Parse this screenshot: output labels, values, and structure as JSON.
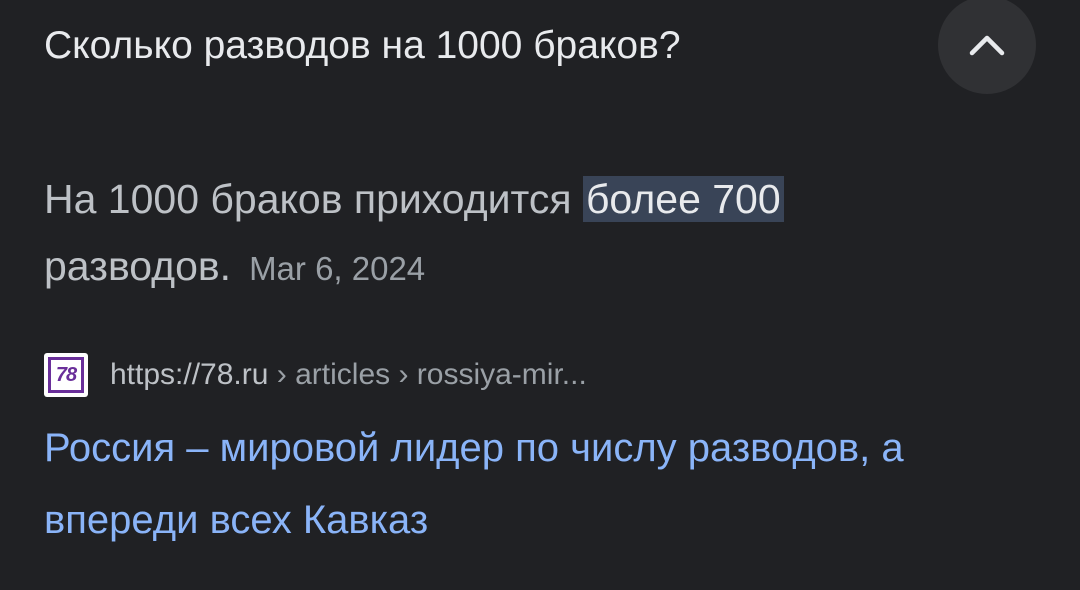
{
  "question": "Сколько разводов на 1000 браков?",
  "answer": {
    "text_before": "На 1000 браков приходится ",
    "highlight": "более 700",
    "text_after": " разводов.",
    "date": "Mar 6, 2024"
  },
  "source": {
    "favicon_text": "78",
    "domain": "https://78.ru",
    "path": " › articles › rossiya-mir..."
  },
  "result_title": "Россия – мировой лидер по числу разводов, а впереди всех Кавказ",
  "icons": {
    "collapse": "chevron-up-icon",
    "favicon": "78ru-logo-icon"
  },
  "colors": {
    "background": "#202124",
    "highlight": "#394457",
    "link": "#8ab4f8"
  }
}
